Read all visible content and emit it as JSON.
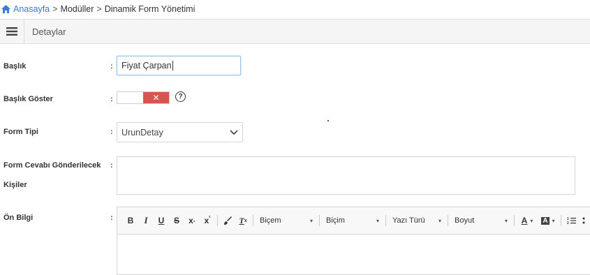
{
  "breadcrumb": {
    "home": "Anasayfa",
    "items": [
      "Modüller",
      "Dinamik Form Yönetimi"
    ],
    "separator": ">"
  },
  "panel": {
    "title": "Detaylar"
  },
  "form": {
    "colon": ":",
    "title_label": "Başlık",
    "title_value": "Fiyat Çarpan",
    "show_title_label": "Başlık Göster",
    "show_title_toggle": "✕",
    "help": "?",
    "form_type_label": "Form Tipi",
    "form_type_value": "UrunDetay",
    "recipients_label_line1": "Form Cevabı Gönderilecek",
    "recipients_label_line2": "Kişiler",
    "preinfo_label": "Ön Bilgi"
  },
  "editor": {
    "bold": "B",
    "italic": "I",
    "underline": "U",
    "strike": "S",
    "subscript": "x",
    "subscript_mark": "₂",
    "superscript": "x",
    "superscript_mark": "²",
    "clear_format": "T",
    "clear_format_mark": "x",
    "style_select": "Biçem",
    "format_select": "Biçim",
    "font_select": "Yazı Türü",
    "size_select": "Boyut",
    "text_color": "A",
    "bg_color": "A",
    "caret": "▾"
  },
  "colors": {
    "link": "#3a7bd5",
    "toggle_off": "#d9534f",
    "input_focus": "#9ec3ef"
  }
}
